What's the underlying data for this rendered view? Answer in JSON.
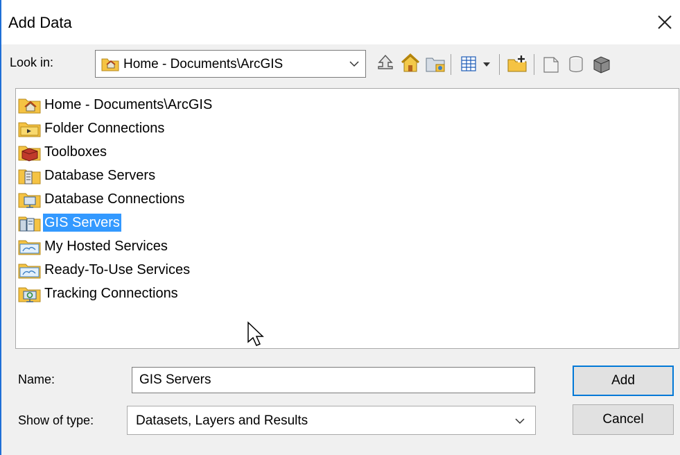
{
  "window": {
    "title": "Add Data",
    "close_icon": "close-icon"
  },
  "lookin": {
    "label": "Look in:",
    "value": "Home - Documents\\ArcGIS",
    "icon": "home-folder-icon"
  },
  "toolbar": {
    "buttons": [
      {
        "name": "up-one-level-icon"
      },
      {
        "name": "home-icon"
      },
      {
        "name": "connect-to-folder-icon"
      },
      {
        "name": "view-menu-icon"
      },
      {
        "name": "new-folder-icon"
      },
      {
        "name": "new-file-geodatabase-icon"
      },
      {
        "name": "new-personal-geodatabase-icon"
      },
      {
        "name": "new-toolbox-icon"
      }
    ]
  },
  "list": {
    "items": [
      {
        "label": "Home - Documents\\ArcGIS",
        "icon": "home-folder-icon"
      },
      {
        "label": "Folder Connections",
        "icon": "folder-connection-icon"
      },
      {
        "label": "Toolboxes",
        "icon": "toolbox-icon"
      },
      {
        "label": "Database Servers",
        "icon": "database-server-icon"
      },
      {
        "label": "Database Connections",
        "icon": "database-connection-icon"
      },
      {
        "label": "GIS Servers",
        "icon": "gis-server-icon",
        "selected": true
      },
      {
        "label": "My Hosted Services",
        "icon": "hosted-services-icon"
      },
      {
        "label": "Ready-To-Use Services",
        "icon": "ready-to-use-services-icon"
      },
      {
        "label": "Tracking Connections",
        "icon": "tracking-connection-icon"
      }
    ]
  },
  "form": {
    "name_label": "Name:",
    "name_value": "GIS Servers",
    "type_label": "Show of type:",
    "type_value": "Datasets, Layers and Results"
  },
  "buttons": {
    "add": "Add",
    "cancel": "Cancel"
  },
  "colors": {
    "selection": "#3399ff",
    "accent": "#0078d7",
    "folder": "#f5c343"
  }
}
